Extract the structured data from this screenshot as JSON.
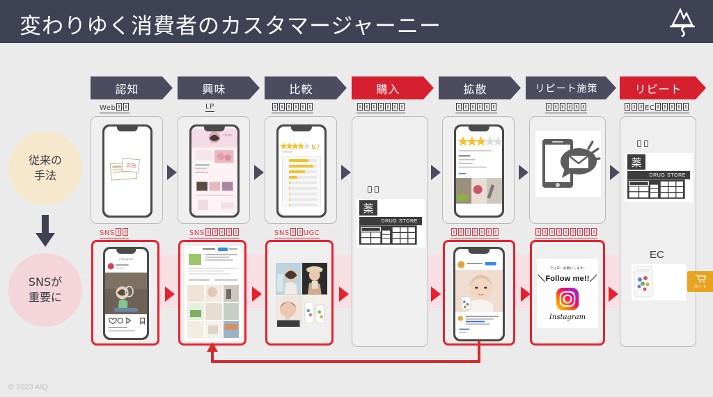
{
  "header": {
    "title": "変わりゆく消費者のカスタマージャーニー",
    "logo_name": "aiq-mountain-logo"
  },
  "rail": {
    "legacy_label": "従来の\n手法",
    "legacy_line1": "従来の",
    "legacy_line2": "手法",
    "sns_line1": "SNSが",
    "sns_line2": "重要に",
    "arrow_name": "down-arrow"
  },
  "stages": [
    {
      "label": "認知",
      "accent": "dark",
      "sub_prefix": "Web",
      "sub_tofu": 2,
      "sub_suffix": ""
    },
    {
      "label": "興味",
      "accent": "dark",
      "sub_prefix": "LP",
      "sub_tofu": 0,
      "sub_suffix": ""
    },
    {
      "label": "比較",
      "accent": "dark",
      "sub_prefix": "",
      "sub_tofu": 6,
      "sub_suffix": ""
    },
    {
      "label": "購入",
      "accent": "red",
      "sub_prefix": "",
      "sub_tofu": 7,
      "sub_suffix": ""
    },
    {
      "label": "拡散",
      "accent": "dark",
      "sub_prefix": "",
      "sub_tofu": 6,
      "sub_suffix": ""
    },
    {
      "label": "リピート施策",
      "accent": "dark",
      "sub_prefix": "",
      "sub_tofu": 6,
      "sub_suffix": ""
    },
    {
      "label": "リピート",
      "accent": "red",
      "sub_prefix": "",
      "sub_tofu": 3,
      "sub_mid": "EC",
      "sub_tofu2": 5
    }
  ],
  "sns_labels": [
    {
      "prefix": "SNS",
      "tofu": 2,
      "suffix": ""
    },
    {
      "prefix": "SNS",
      "tofu": 5,
      "suffix": ""
    },
    {
      "prefix": "SNS",
      "tofu": 2,
      "suffix": "UGC"
    },
    {
      "prefix": "",
      "tofu": 7,
      "suffix": ""
    },
    {
      "prefix": "",
      "tofu": 9,
      "suffix": ""
    }
  ],
  "store": {
    "sign_text": "薬",
    "band_text": "DRUG STORE"
  },
  "ec": {
    "label": "EC",
    "cart_caption": "カート",
    "cart_icon": "shopping-cart-icon"
  },
  "review_phone": {
    "score": "5.7",
    "star_count": 5
  },
  "follow_card": {
    "sub": "フォローお願いします♪",
    "main": "＼Follow me!!／",
    "wordmark": "Instagram",
    "logo_name": "instagram-logo"
  },
  "colors": {
    "header_bg": "#3f4154",
    "banner_dark": "#4b4c60",
    "banner_red": "#d62030",
    "accent_red": "#e8212e",
    "pink_band": "#f8dfe3",
    "legacy_circle": "#f5e8cd",
    "sns_circle": "#f3d5da",
    "page_bg": "#ebebeb"
  },
  "footer": {
    "copyright": "© 2023 AIQ"
  }
}
